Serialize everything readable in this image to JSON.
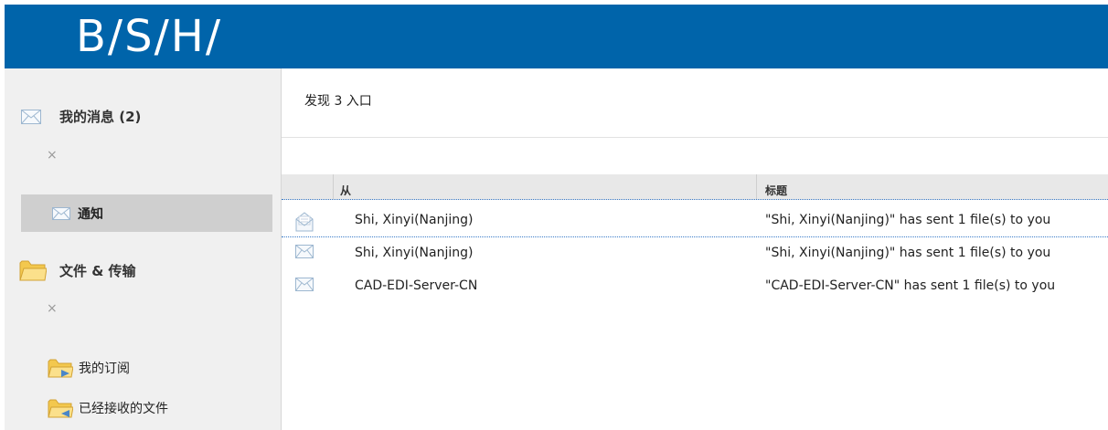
{
  "header": {
    "logo_text": "B/S/H/",
    "brand_color": "#0064aa"
  },
  "sidebar": {
    "messages": {
      "icon": "envelope-icon",
      "label": "我的消息 (2)",
      "close": "×"
    },
    "notification": {
      "icon": "envelope-icon",
      "label": "通知"
    },
    "files": {
      "icon": "folder-icon",
      "label": "文件 & 传输",
      "close": "×"
    },
    "items": [
      {
        "icon": "folder-subscription-icon",
        "label": "我的订阅"
      },
      {
        "icon": "folder-received-icon",
        "label": "已经接收的文件"
      }
    ]
  },
  "main": {
    "found_text": "发现 3 入口",
    "table": {
      "columns": [
        "从",
        "标题"
      ],
      "rows": [
        {
          "icon": "open-envelope-icon",
          "from": "Shi, Xinyi(Nanjing)",
          "title": "\"Shi, Xinyi(Nanjing)\" has sent 1 file(s) to you"
        },
        {
          "icon": "envelope-icon",
          "from": "Shi, Xinyi(Nanjing)",
          "title": "\"Shi, Xinyi(Nanjing)\" has sent 1 file(s) to you"
        },
        {
          "icon": "envelope-icon",
          "from": "CAD-EDI-Server-CN",
          "title": "\"CAD-EDI-Server-CN\" has sent 1 file(s) to you"
        }
      ]
    }
  }
}
